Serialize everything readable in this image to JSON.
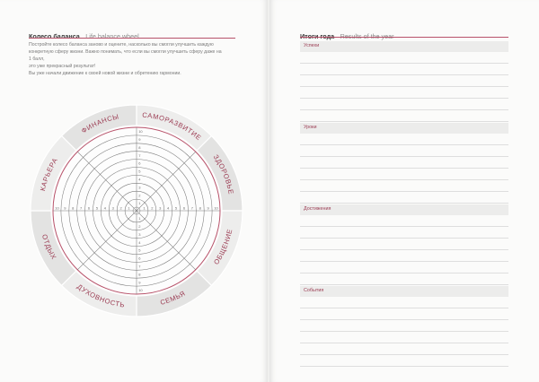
{
  "left_page": {
    "title_ru": "Колесо баланса",
    "title_en": "Life balance wheel",
    "intro_lines": [
      "Постройте колесо баланса заново и оцените, насколько вы смогли улучшить каждую",
      "конкретную сферу жизни. Важно понимать, что если вы смогли улучшить сферу даже на 1 балл,",
      "это уже прекрасный результат!",
      "Вы уже начали движение к своей новой жизни и обретению гармонии."
    ]
  },
  "wheel": {
    "scale_max": 10,
    "sectors": [
      "ФИНАНСЫ",
      "САМОРАЗВИТИЕ",
      "ЗДОРОВЬЕ",
      "ОБЩЕНИЕ",
      "СЕМЬЯ",
      "ДУХОВНОСТЬ",
      "ОТДЫХ",
      "КАРЬЕРА"
    ],
    "scale_labels": [
      "1",
      "2",
      "3",
      "4",
      "5",
      "6",
      "7",
      "8",
      "9",
      "10"
    ],
    "colors": {
      "band": "#e6e6e5",
      "accent": "#b8526a",
      "label": "#9b3b52",
      "grid": "#7a7a7a"
    }
  },
  "right_page": {
    "title_ru": "Итоги года",
    "title_en": "Results of the year",
    "sections": [
      {
        "label": "Успехи"
      },
      {
        "label": "Уроки"
      },
      {
        "label": "Достижения"
      },
      {
        "label": "События"
      }
    ]
  }
}
